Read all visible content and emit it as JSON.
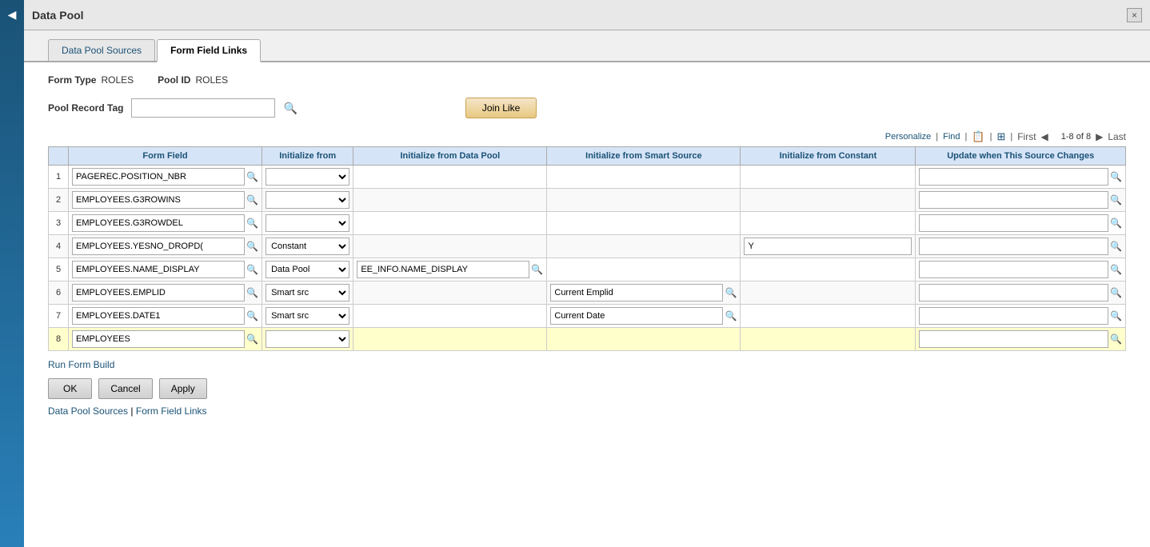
{
  "title": "Data Pool",
  "close_label": "×",
  "tabs": [
    {
      "label": "Data Pool Sources",
      "active": false
    },
    {
      "label": "Form Field Links",
      "active": true
    }
  ],
  "form_meta": {
    "form_type_label": "Form Type",
    "form_type_value": "ROLES",
    "pool_id_label": "Pool ID",
    "pool_id_value": "ROLES",
    "pool_record_tag_label": "Pool Record Tag",
    "pool_record_tag_value": ""
  },
  "join_like_label": "Join Like",
  "toolbar": {
    "personalize": "Personalize",
    "find": "Find",
    "pagination": "1-8 of 8",
    "first": "First",
    "last": "Last"
  },
  "columns": [
    {
      "label": "Form Field"
    },
    {
      "label": "Initialize from"
    },
    {
      "label": "Initialize from Data Pool"
    },
    {
      "label": "Initialize from Smart Source"
    },
    {
      "label": "Initialize from Constant"
    },
    {
      "label": "Update when This Source Changes"
    }
  ],
  "rows": [
    {
      "num": "1",
      "form_field": "PAGEREC.POSITION_NBR",
      "initialize_from": "",
      "init_data_pool": "",
      "init_smart_source": "",
      "init_constant": "",
      "update_source": "",
      "highlighted": false
    },
    {
      "num": "2",
      "form_field": "EMPLOYEES.G3ROWINS",
      "initialize_from": "",
      "init_data_pool": "",
      "init_smart_source": "",
      "init_constant": "",
      "update_source": "",
      "highlighted": false
    },
    {
      "num": "3",
      "form_field": "EMPLOYEES.G3ROWDEL",
      "initialize_from": "",
      "init_data_pool": "",
      "init_smart_source": "",
      "init_constant": "",
      "update_source": "",
      "highlighted": false
    },
    {
      "num": "4",
      "form_field": "EMPLOYEES.YESNO_DROPD(",
      "initialize_from": "Constant",
      "init_data_pool": "",
      "init_smart_source": "",
      "init_constant": "Y",
      "update_source": "",
      "highlighted": false
    },
    {
      "num": "5",
      "form_field": "EMPLOYEES.NAME_DISPLAY",
      "initialize_from": "Data Pool",
      "init_data_pool": "EE_INFO.NAME_DISPLAY",
      "init_smart_source": "",
      "init_constant": "",
      "update_source": "",
      "highlighted": false
    },
    {
      "num": "6",
      "form_field": "EMPLOYEES.EMPLID",
      "initialize_from": "Smart src",
      "init_data_pool": "",
      "init_smart_source": "Current Emplid",
      "init_constant": "",
      "update_source": "",
      "highlighted": false
    },
    {
      "num": "7",
      "form_field": "EMPLOYEES.DATE1",
      "initialize_from": "Smart src",
      "init_data_pool": "",
      "init_smart_source": "Current Date",
      "init_constant": "",
      "update_source": "",
      "highlighted": false
    },
    {
      "num": "8",
      "form_field": "EMPLOYEES",
      "initialize_from": "",
      "init_data_pool": "",
      "init_smart_source": "",
      "init_constant": "",
      "update_source": "",
      "highlighted": true
    }
  ],
  "run_form_build_label": "Run Form Build",
  "buttons": {
    "ok": "OK",
    "cancel": "Cancel",
    "apply": "Apply"
  },
  "bottom_links": {
    "data_pool_sources": "Data Pool Sources",
    "separator": " | ",
    "form_field_links": "Form Field Links"
  },
  "select_options": {
    "empty": "",
    "constant": "Constant",
    "data_pool": "Data Pool",
    "smart_src": "Smart src"
  }
}
